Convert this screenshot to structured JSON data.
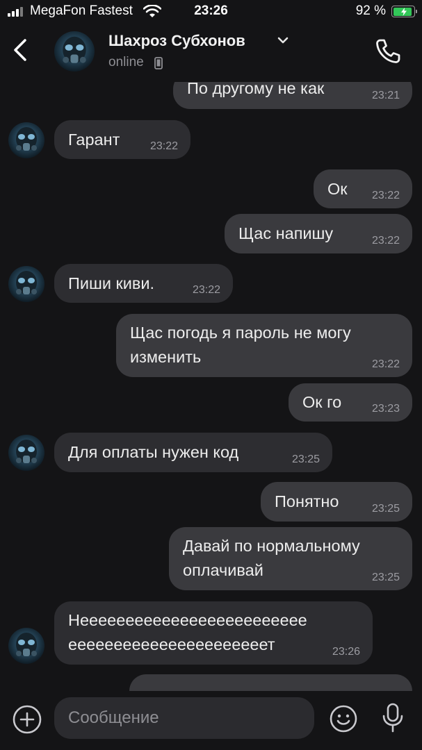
{
  "status_bar": {
    "carrier": "MegaFon Fastest",
    "time": "23:26",
    "battery": "92 %"
  },
  "header": {
    "contact_name": "Шахроз Субхонов",
    "status": "online"
  },
  "messages": [
    {
      "direction": "out",
      "text": "По другому не как",
      "time": "23:21"
    },
    {
      "direction": "in",
      "text": "Гарант",
      "time": "23:22"
    },
    {
      "direction": "out",
      "text": "Ок",
      "time": "23:22"
    },
    {
      "direction": "out",
      "text": "Щас напишу",
      "time": "23:22"
    },
    {
      "direction": "in",
      "text": "Пиши киви.",
      "time": "23:22"
    },
    {
      "direction": "out",
      "text": "Щас погодь я пароль не могу\nизменить",
      "time": "23:22"
    },
    {
      "direction": "out",
      "text": "Ок го",
      "time": "23:23"
    },
    {
      "direction": "in",
      "text": "Для оплаты нужен код",
      "time": "23:25"
    },
    {
      "direction": "out",
      "text": "Понятно",
      "time": "23:25"
    },
    {
      "direction": "out",
      "text": "Давай по нормальному\nоплачивай",
      "time": "23:25"
    },
    {
      "direction": "in",
      "text": "Неееееееееееееееееееееееее\nеееееееееееееееееееееет",
      "time": "23:26"
    }
  ],
  "input": {
    "placeholder": "Сообщение"
  },
  "colors": {
    "background": "#141416",
    "incoming_bubble": "#2d2d31",
    "outgoing_bubble": "#3a3a3e",
    "battery_green": "#33c759"
  },
  "icons": [
    "back-chevron-icon",
    "contact-avatar-icon",
    "dropdown-chevron-icon",
    "mobile-device-icon",
    "phone-icon",
    "plus-icon",
    "emoji-icon",
    "microphone-icon"
  ]
}
